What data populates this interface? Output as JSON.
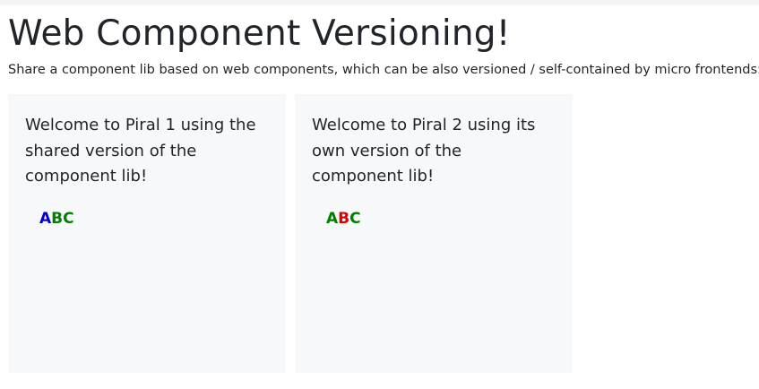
{
  "title": "Web Component Versioning!",
  "subtitle": "Share a component lib based on web components, which can be also versioned / self-contained by micro frontends:",
  "cards": [
    {
      "text": "Welcome to Piral 1 using the shared version of the component lib!",
      "abc": [
        {
          "char": "A",
          "color": "#0000cc"
        },
        {
          "char": "B",
          "color": "#008000"
        },
        {
          "char": "C",
          "color": "#008000"
        }
      ]
    },
    {
      "text": "Welcome to Piral 2 using its own version of the component lib!",
      "abc": [
        {
          "char": "A",
          "color": "#008000"
        },
        {
          "char": "B",
          "color": "#e00000"
        },
        {
          "char": "C",
          "color": "#008000"
        }
      ]
    }
  ]
}
